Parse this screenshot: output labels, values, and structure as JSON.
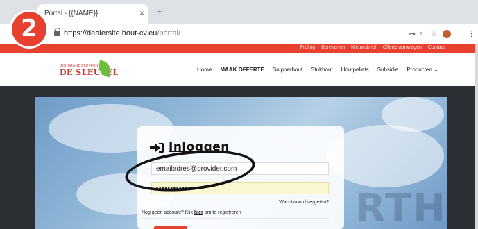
{
  "browser": {
    "tab_title": "Portal - {{NAME}}",
    "tab_close": "×",
    "new_tab": "+",
    "url_base": "https://dealersite.hout-cv.eu",
    "url_path": "/portal/",
    "key_icon": "⊶",
    "zoom_icon": "⌕",
    "star_icon": "☆",
    "menu_icon": "⋮"
  },
  "badge": {
    "label": "2"
  },
  "topbar": {
    "links": [
      "Fröling",
      "Berekenen",
      "Nieuwsbrief",
      "Offerte aanvragen",
      "Contact"
    ]
  },
  "site": {
    "logo_small": "BIO-BRANDSTOFFEN.NL",
    "logo_text": "DE SLEUTEL",
    "nav": [
      "Home",
      "MAAK OFFERTE",
      "Snipperhout",
      "Stukhout",
      "Houtpellets",
      "Subsidie",
      "Producten ⌄"
    ],
    "watermark": "RTH"
  },
  "login": {
    "title": "Inloggen",
    "email_value": "emailadres@provider.com",
    "password_value": "•••••••••••",
    "forgot": "Wachtwoord vergeten?",
    "register_before": "Nog geen account? Klik ",
    "register_link": "hier",
    "register_after": " om te registreren"
  },
  "colors": {
    "accent": "#e8412f",
    "leaf": "#6cbf3a",
    "autofill": "#faf7d0"
  }
}
